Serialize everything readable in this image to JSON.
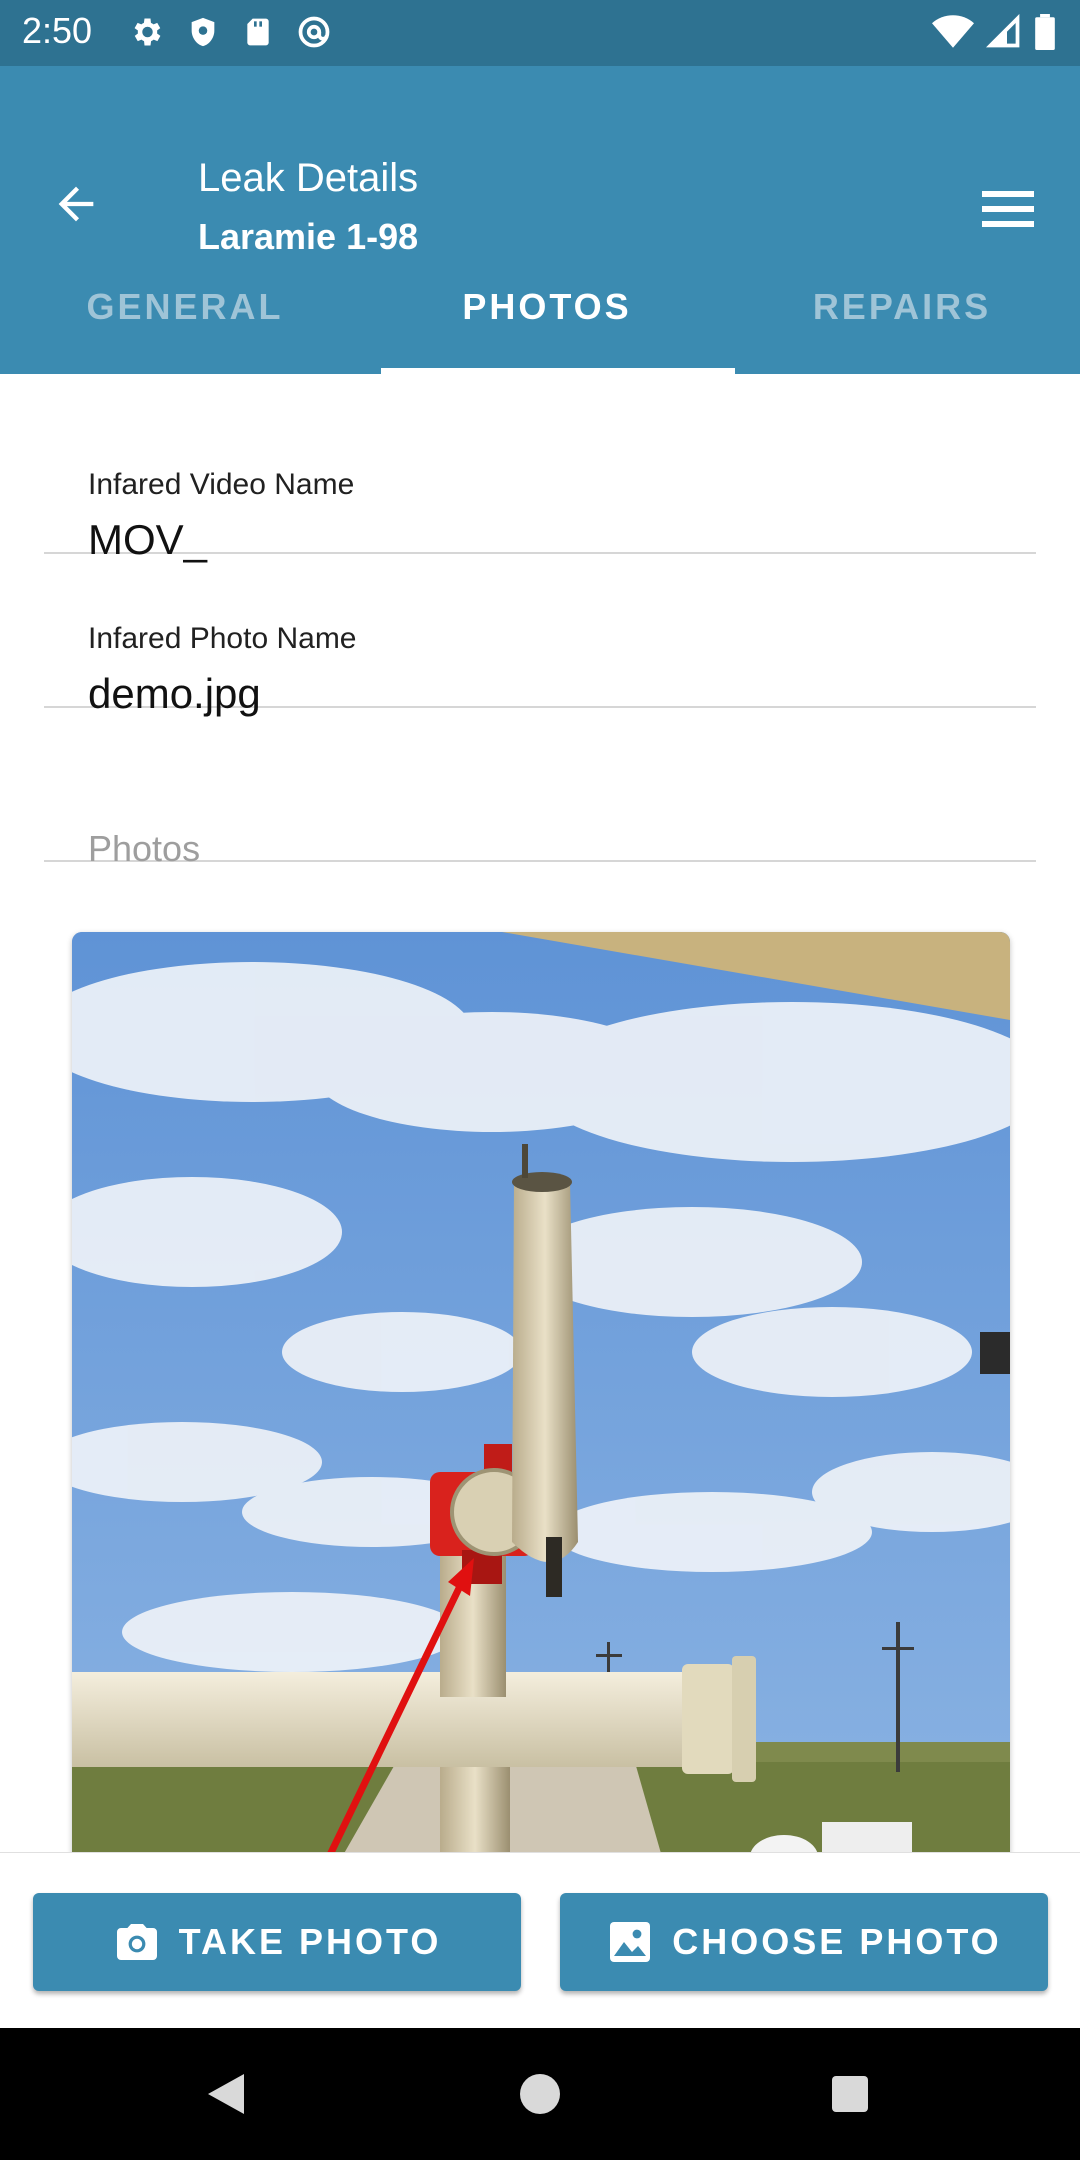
{
  "status_bar": {
    "time": "2:50",
    "left_icons": [
      "gear-icon",
      "shield-icon",
      "sd-card-icon",
      "at-sign-icon"
    ],
    "right_icons": [
      "wifi-icon",
      "signal-icon",
      "battery-icon"
    ]
  },
  "app_bar": {
    "title": "Leak Details",
    "subtitle": "Laramie 1-98",
    "background_color": "#3b8bb1"
  },
  "tabs": [
    {
      "label": "GENERAL",
      "active": false
    },
    {
      "label": "PHOTOS",
      "active": true
    },
    {
      "label": "REPAIRS",
      "active": false
    }
  ],
  "form": {
    "video_name": {
      "label": "Infared Video Name",
      "value": "MOV_"
    },
    "photo_name": {
      "label": "Infared Photo Name",
      "value": "demo.jpg"
    },
    "photos_placeholder": "Photos"
  },
  "photo": {
    "description": "vent pipe with red valve under cloudy blue sky, red arrow pointing to valve"
  },
  "actions": {
    "take_photo": "TAKE PHOTO",
    "choose_photo": "CHOOSE PHOTO"
  }
}
